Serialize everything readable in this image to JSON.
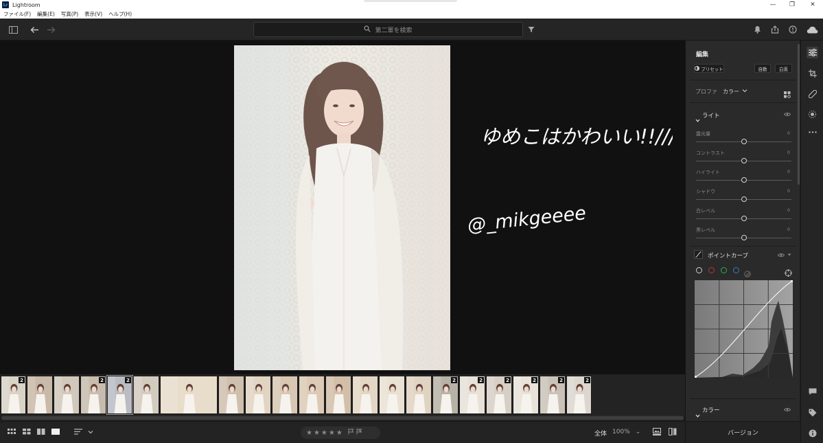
{
  "window": {
    "app_icon": "Lr",
    "title": "Lightroom",
    "controls": {
      "minimize": "—",
      "maximize": "❐",
      "close": "✕"
    }
  },
  "menu": [
    {
      "label": "ファイル(F)"
    },
    {
      "label": "編集(E)"
    },
    {
      "label": "写真(P)"
    },
    {
      "label": "表示(V)"
    },
    {
      "label": "ヘルプ(H)"
    }
  ],
  "toolbar": {
    "search_placeholder": "第二軍を検索",
    "icons": [
      "sidebar-toggle-icon",
      "back-arrow-icon",
      "forward-arrow-icon",
      "filter-icon",
      "bell-icon",
      "share-icon",
      "help-icon",
      "cloud-icon"
    ]
  },
  "annotation": {
    "line1": "ゆめこはかわいい!!///",
    "line2": "@_mikgeeee"
  },
  "filmstrip": {
    "thumbs": [
      {
        "badge": "2"
      },
      {
        "badge": ""
      },
      {
        "badge": ""
      },
      {
        "badge": "2"
      },
      {
        "badge": "2",
        "selected": true
      },
      {
        "badge": ""
      },
      {
        "badge": ""
      },
      {
        "badge": ""
      },
      {
        "badge": ""
      },
      {
        "badge": ""
      },
      {
        "badge": ""
      },
      {
        "badge": ""
      },
      {
        "badge": ""
      },
      {
        "badge": ""
      },
      {
        "badge": ""
      },
      {
        "badge": "2"
      },
      {
        "badge": "2"
      },
      {
        "badge": "2"
      },
      {
        "badge": "2"
      },
      {
        "badge": "2"
      },
      {
        "badge": "2"
      }
    ]
  },
  "bottombar": {
    "stars": "★★★★★",
    "zoom_label": "全体",
    "zoom_value": "100%",
    "zoom_caret": "⌄"
  },
  "panel": {
    "title": "編集",
    "preset_label": "プリセット",
    "auto_label": "自動",
    "bw_label": "白黒",
    "profile_prefix": "プロファ",
    "profile_value": "カラー",
    "light_title": "ライト",
    "sliders": [
      {
        "label": "露光量",
        "value": "0",
        "position": 0.5
      },
      {
        "label": "コントラスト",
        "value": "0",
        "position": 0.5
      },
      {
        "label": "ハイライト",
        "value": "0",
        "position": 0.5
      },
      {
        "label": "シャドウ",
        "value": "0",
        "position": 0.5
      },
      {
        "label": "白レベル",
        "value": "0",
        "position": 0.5
      },
      {
        "label": "黒レベル",
        "value": "0",
        "position": 0.5
      }
    ],
    "curve_title": "ポイントカーブ",
    "curve_channels": [
      "#cfcfcf",
      "#c0392b",
      "#27ae60",
      "#2980b9"
    ],
    "color_title": "カラー",
    "version_label": "バージョン"
  },
  "tools": [
    "sliders-icon",
    "crop-icon",
    "healing-icon",
    "masking-icon",
    "more-icon",
    "comment-icon",
    "tag-icon",
    "info-icon"
  ]
}
